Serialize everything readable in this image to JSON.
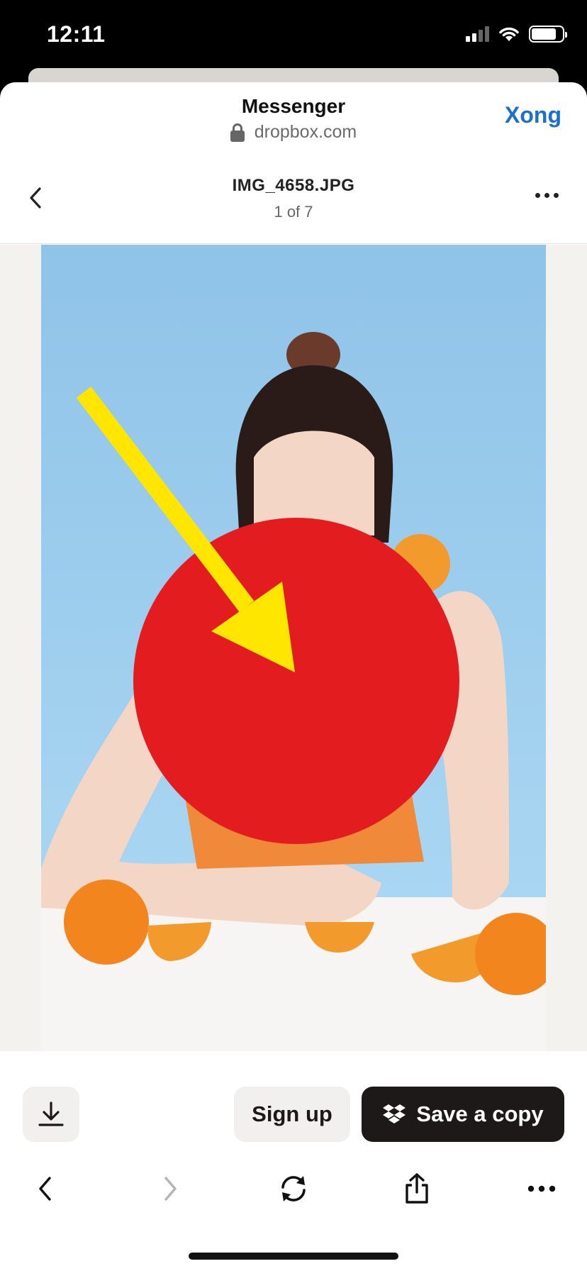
{
  "status_bar": {
    "time": "12:11"
  },
  "sheet": {
    "title": "Messenger",
    "url": "dropbox.com",
    "done_label": "Xong"
  },
  "file": {
    "name": "IMG_4658.JPG",
    "counter": "1 of 7"
  },
  "actions": {
    "signup_label": "Sign up",
    "save_label": "Save a copy"
  },
  "colors": {
    "accent_link": "#1a6fd1",
    "primary_button": "#1e1919",
    "secondary_button": "#f1f0ee",
    "photo_background": "#9dcdee",
    "overlay_circle": "#e31c1f",
    "overlay_arrow": "#ffe600"
  },
  "icons": {
    "back": "chevron-left-icon",
    "more": "more-horizontal-icon",
    "download": "download-icon",
    "dropbox": "dropbox-logo-icon",
    "lock": "lock-icon",
    "browser_back": "chevron-left-icon",
    "browser_forward": "chevron-right-icon",
    "reload": "reload-icon",
    "share": "share-icon"
  }
}
